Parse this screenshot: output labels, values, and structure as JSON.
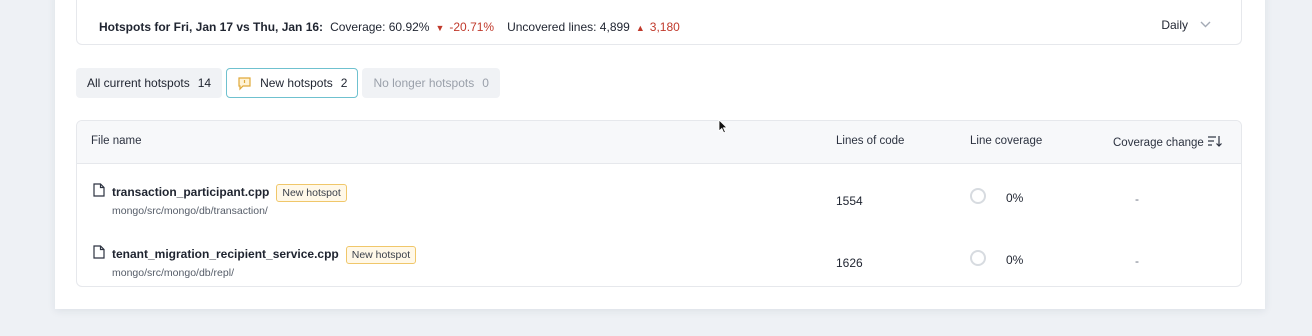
{
  "summary": {
    "title": "Hotspots for Fri, Jan 17 vs Thu, Jan 16:",
    "coverage_label": "Coverage: 60.92%",
    "coverage_delta": "-20.71%",
    "uncovered_label": "Uncovered lines: 4,899",
    "uncovered_delta": "3,180",
    "period": "Daily"
  },
  "tabs": [
    {
      "label": "All current hotspots",
      "count": "14"
    },
    {
      "label": "New hotspots",
      "count": "2"
    },
    {
      "label": "No longer hotspots",
      "count": "0"
    }
  ],
  "table": {
    "headers": {
      "file_name": "File name",
      "lines_of_code": "Lines of code",
      "line_coverage": "Line coverage",
      "coverage_change": "Coverage change"
    },
    "rows": [
      {
        "file": "transaction_participant.cpp",
        "badge": "New hotspot",
        "path": "mongo/src/mongo/db/transaction/",
        "lines": "1554",
        "coverage": "0%",
        "change": "-"
      },
      {
        "file": "tenant_migration_recipient_service.cpp",
        "badge": "New hotspot",
        "path": "mongo/src/mongo/db/repl/",
        "lines": "1626",
        "coverage": "0%",
        "change": "-"
      }
    ]
  },
  "colors": {
    "accent_border": "#6fc1cf",
    "negative": "#c0392b",
    "badge_border": "#f0c76a"
  }
}
